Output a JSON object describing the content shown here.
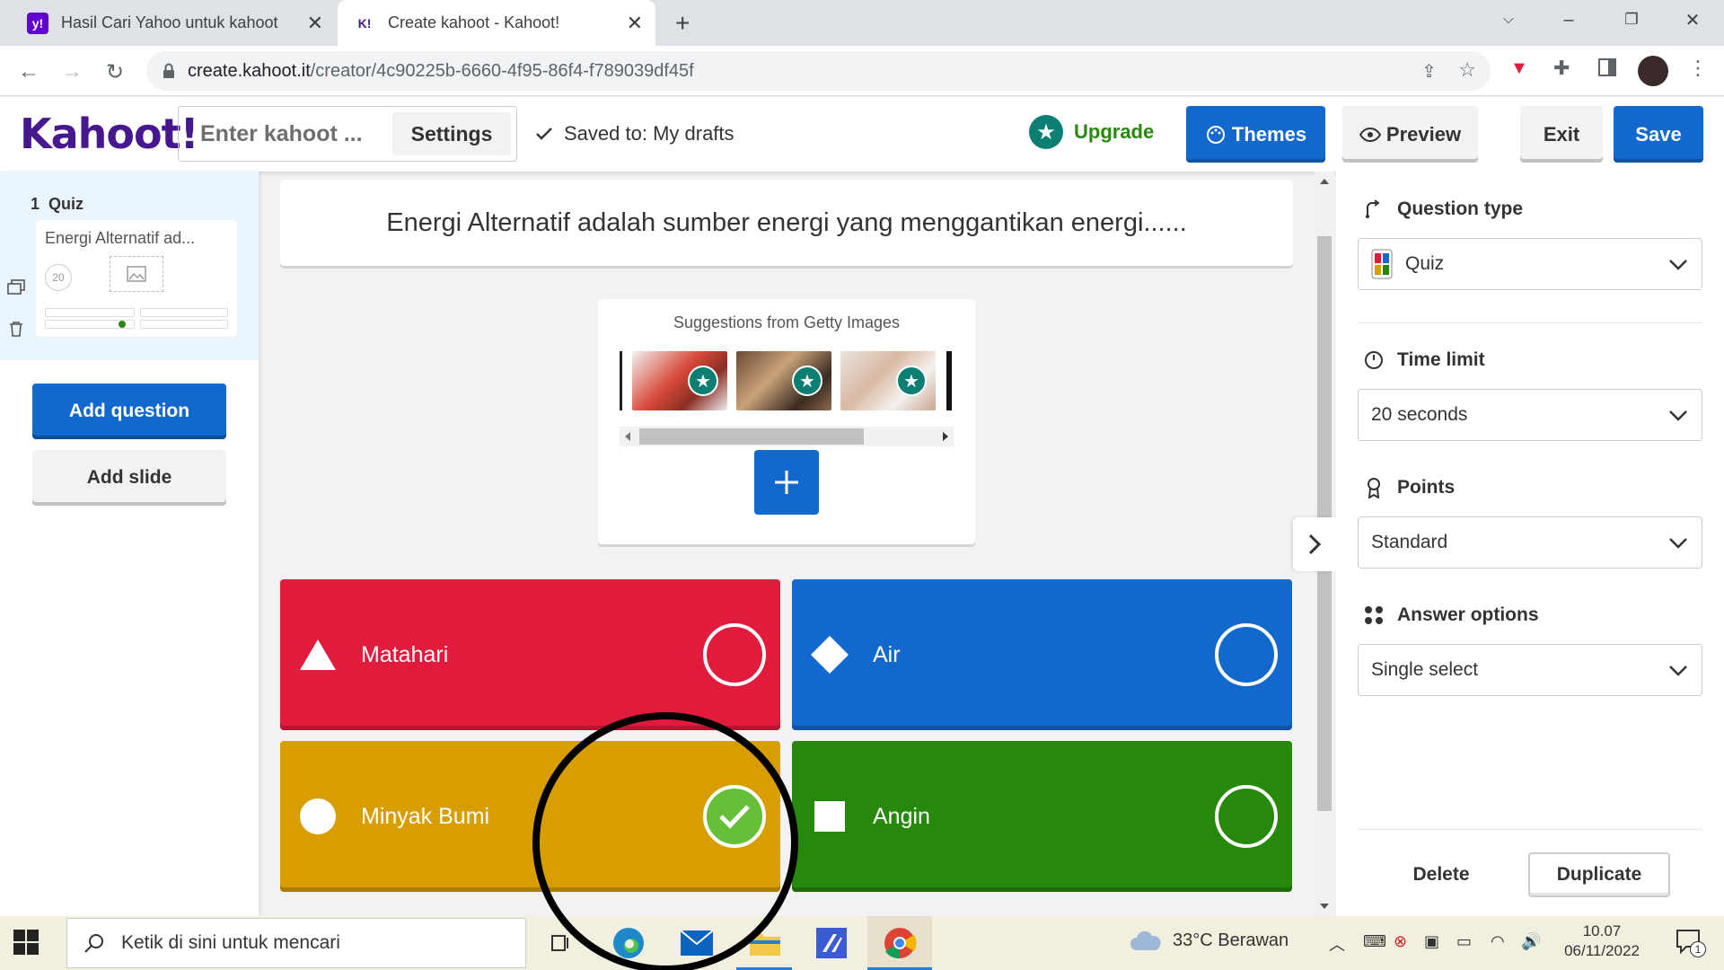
{
  "browser": {
    "tabs": [
      {
        "title": "Hasil Cari Yahoo untuk kahoot",
        "favicon": "yahoo-favicon",
        "favicon_text": "y!"
      },
      {
        "title": "Create kahoot - Kahoot!",
        "favicon": "kahoot-favicon",
        "favicon_text": "K!"
      }
    ],
    "url_host": "create.kahoot.it",
    "url_path": "/creator/4c90225b-6660-4f95-86f4-f789039df45f"
  },
  "header": {
    "logo": "Kahoot!",
    "title_placeholder": "Enter kahoot ...",
    "settings": "Settings",
    "saved": "Saved to: My drafts",
    "upgrade": "Upgrade",
    "themes": "Themes",
    "preview": "Preview",
    "exit": "Exit",
    "save": "Save"
  },
  "sidebar": {
    "slide_number": "1",
    "slide_type": "Quiz",
    "thumb_title": "Energi Alternatif ad...",
    "thumb_timer": "20",
    "add_question": "Add question",
    "add_slide": "Add slide"
  },
  "question": {
    "text": "Energi Alternatif adalah sumber energi yang menggantikan energi......"
  },
  "media": {
    "suggestions_label": "Suggestions from Getty Images",
    "add_icon": "plus-icon"
  },
  "answers": [
    {
      "text": "Matahari",
      "shape": "triangle",
      "color": "#e21b3c",
      "correct": false
    },
    {
      "text": "Air",
      "shape": "diamond",
      "color": "#1368ce",
      "correct": false
    },
    {
      "text": "Minyak Bumi",
      "shape": "circle",
      "color": "#d89e00",
      "correct": true
    },
    {
      "text": "Angin",
      "shape": "square",
      "color": "#26890c",
      "correct": false
    }
  ],
  "settings_panel": {
    "question_type_label": "Question type",
    "question_type_value": "Quiz",
    "time_limit_label": "Time limit",
    "time_limit_value": "20 seconds",
    "points_label": "Points",
    "points_value": "Standard",
    "answer_options_label": "Answer options",
    "answer_options_value": "Single select",
    "delete": "Delete",
    "duplicate": "Duplicate"
  },
  "taskbar": {
    "search_placeholder": "Ketik di sini untuk mencari",
    "weather": "33°C  Berawan",
    "time": "10.07",
    "date": "06/11/2022",
    "notification_count": "1"
  },
  "colors": {
    "kahoot_purple": "#46178f",
    "primary_blue": "#1368ce",
    "upgrade_green": "#26890c",
    "correct_green": "#66bf39"
  }
}
